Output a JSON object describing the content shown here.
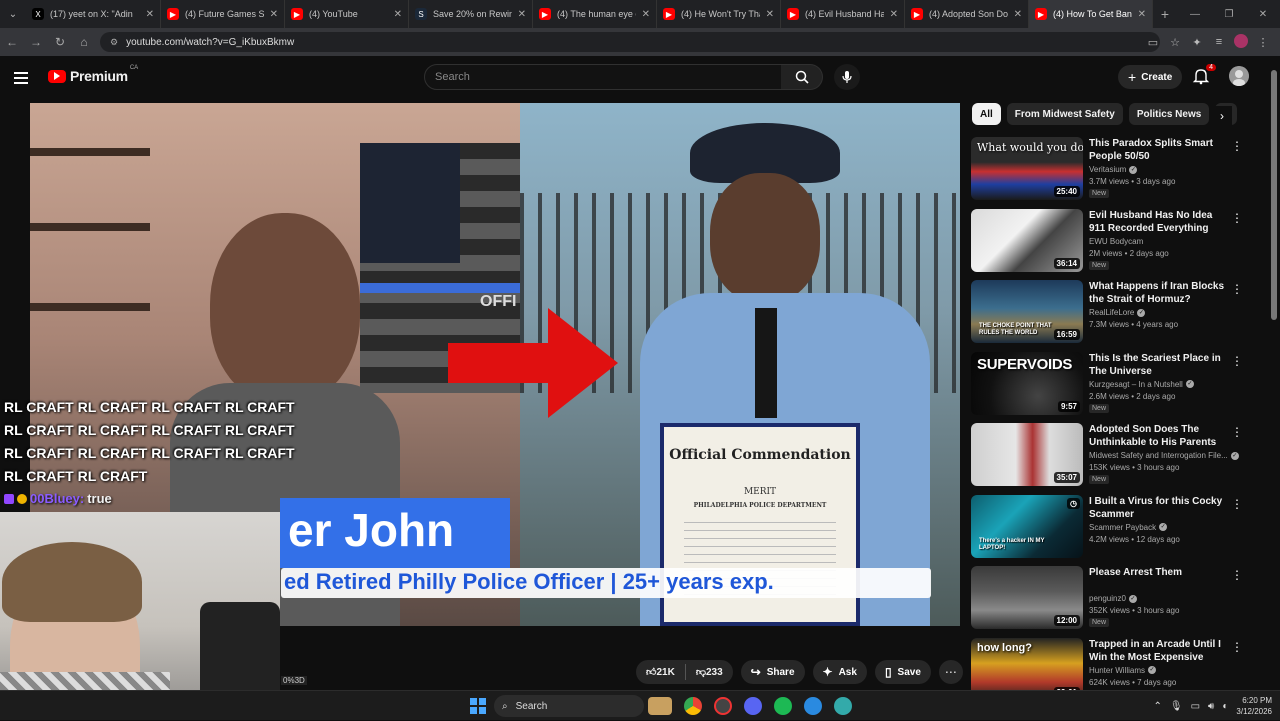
{
  "tabs": [
    {
      "title": "(17) yeet on X: \"Adin",
      "fav_color": "#000000",
      "fav_glyph": "X",
      "width": 135
    },
    {
      "title": "(4) Future Games Sho",
      "fav_color": "#ff0000",
      "fav_glyph": "▶",
      "width": 124
    },
    {
      "title": "(4) YouTube",
      "fav_color": "#ff0000",
      "fav_glyph": "▶",
      "width": 124
    },
    {
      "title": "Save 20% on Rewind",
      "fav_color": "#1b2838",
      "fav_glyph": "S",
      "width": 124
    },
    {
      "title": "(4) The human eye ca",
      "fav_color": "#ff0000",
      "fav_glyph": "▶",
      "width": 124
    },
    {
      "title": "(4) He Won't Try That",
      "fav_color": "#ff0000",
      "fav_glyph": "▶",
      "width": 124
    },
    {
      "title": "(4) Evil Husband Has",
      "fav_color": "#ff0000",
      "fav_glyph": "▶",
      "width": 124
    },
    {
      "title": "(4) Adopted Son Doe",
      "fav_color": "#ff0000",
      "fav_glyph": "▶",
      "width": 124
    },
    {
      "title": "(4) How To Get Bann",
      "fav_color": "#ff0000",
      "fav_glyph": "▶",
      "width": 124,
      "active": true
    }
  ],
  "address": {
    "url": "youtube.com/watch?v=G_iKbuxBkmw"
  },
  "header": {
    "logo_word": "Premium",
    "logo_country": "CA",
    "search_placeholder": "Search",
    "create_label": "Create",
    "notif_count": "4"
  },
  "video": {
    "name_text": "er John",
    "sub_text": "ed Retired Philly Police Officer | 25+ years exp.",
    "flag_text": "OFFI",
    "cert_title": "Official Commendation",
    "cert_merit": "MERIT",
    "cert_dept": "PHILADELPHIA POLICE DEPARTMENT"
  },
  "stream": {
    "lines": [
      "RL CRAFT RL CRAFT RL CRAFT RL CRAFT",
      "RL CRAFT RL CRAFT RL CRAFT RL CRAFT",
      "RL CRAFT RL CRAFT RL CRAFT RL CRAFT",
      "RL CRAFT RL CRAFT"
    ],
    "chat_user": "00Bluey:",
    "chat_msg": "true",
    "cam_tag": "0%3D"
  },
  "actions": {
    "likes": "21K",
    "dislikes": "233",
    "share": "Share",
    "ask": "Ask",
    "save": "Save"
  },
  "chips": [
    "All",
    "From Midwest Safety",
    "Politics News",
    "F"
  ],
  "recommendations": [
    {
      "title": "This Paradox Splits Smart People 50/50",
      "channel": "Veritasium",
      "verified": true,
      "stats": "3.7M views • 3 days ago",
      "new": "New",
      "duration": "25:40",
      "overlay": "What would you do?",
      "overlay2": "",
      "thumb": "linear-gradient(180deg,#2b2b2b 0%,#2b2b2b 40%,#c83030 55%,#1f3fa0 75%,#1a1a1a 100%)",
      "style": "serif"
    },
    {
      "title": "Evil Husband Has No Idea 911 Recorded Everything",
      "channel": "EWU Bodycam",
      "verified": false,
      "stats": "2M views • 2 days ago",
      "new": "New",
      "duration": "36:14",
      "overlay": "",
      "overlay2": "",
      "thumb": "linear-gradient(135deg,#dadada 0%,#f2f2f2 40%,#444 60%,#9a9a9a 100%)",
      "style": ""
    },
    {
      "title": "What Happens if Iran Blocks the Strait of Hormuz?",
      "channel": "RealLifeLore",
      "verified": true,
      "stats": "7.3M views • 4 years ago",
      "new": "",
      "duration": "16:59",
      "overlay": "",
      "overlay2": "THE CHOKE POINT THAT RULES THE WORLD",
      "thumb": "linear-gradient(180deg,#1d3a5a 0%,#3c6e8e 45%,#8a7a52 70%,#1a2a3a 100%)",
      "style": ""
    },
    {
      "title": "This Is the Scariest Place in The Universe",
      "channel": "Kurzgesagt – In a Nutshell",
      "verified": true,
      "stats": "2.6M views • 2 days ago",
      "new": "New",
      "duration": "9:57",
      "overlay": "SUPERVOIDS",
      "overlay2": "",
      "thumb": "radial-gradient(circle at 60% 70%,#444 0%,#111 60%,#050505 100%)",
      "style": "big"
    },
    {
      "title": "Adopted Son Does The Unthinkable to His Parents",
      "channel": "Midwest Safety and Interrogation File...",
      "verified": true,
      "stats": "153K views • 3 hours ago",
      "new": "New",
      "duration": "35:07",
      "overlay": "",
      "overlay2": "",
      "thumb": "linear-gradient(90deg,#cfcfcf 0%,#e6e6e6 40%,#a33 55%,#ddd 70%,#bbb 100%)",
      "style": ""
    },
    {
      "title": "I Built a Virus for this Cocky Scammer",
      "channel": "Scammer Payback",
      "verified": true,
      "stats": "4.2M views • 12 days ago",
      "new": "",
      "duration": "",
      "overlay": "",
      "overlay2": "There's a hacker IN MY LAPTOP!",
      "thumb": "linear-gradient(135deg,#0d5e6e 0%,#1aa3b8 35%,#0b2a35 70%,#061218 100%)",
      "style": ""
    },
    {
      "title": "Please Arrest Them",
      "channel": "penguinz0",
      "verified": true,
      "stats": "352K views • 3 hours ago",
      "new": "New",
      "duration": "12:00",
      "overlay": "",
      "overlay2": "",
      "thumb": "linear-gradient(180deg,#3a3a3a 0%,#5a5a5a 40%,#8a8a8a 70%,#2a2a2a 100%)",
      "style": ""
    },
    {
      "title": "Trapped in an Arcade Until I Win the Most Expensive Prize",
      "channel": "Hunter Williams",
      "verified": true,
      "stats": "624K views • 7 days ago",
      "new": "",
      "duration": "39:01",
      "overlay": "how long?",
      "overlay2": "",
      "thumb": "linear-gradient(180deg,#222 0%,#d6a020 40%,#b23a2a 70%,#1a1a1a 100%)",
      "style": ""
    }
  ],
  "taskbar": {
    "search_label": "Search",
    "time": "6:20 PM",
    "date": "3/12/2026"
  }
}
